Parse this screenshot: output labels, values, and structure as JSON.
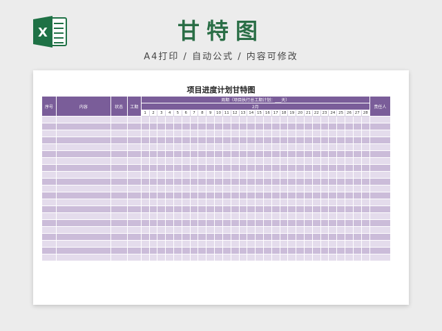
{
  "header": {
    "title": "甘特图",
    "subtitle": "A4打印 / 自动公式 / 内容可修改",
    "logo": {
      "icon": "excel-icon",
      "letter": "X",
      "color": "#1e7145"
    }
  },
  "sheet": {
    "title": "项目进度计划甘特图",
    "columns": {
      "no": "序号",
      "content": "内容",
      "status": "状态",
      "hours": "工期",
      "owner": "责任人"
    },
    "period_label": "周期（项目执行总工期计划：___天）",
    "month_label": "2月",
    "days": [
      "1",
      "2",
      "3",
      "4",
      "5",
      "6",
      "7",
      "8",
      "9",
      "10",
      "11",
      "12",
      "13",
      "14",
      "15",
      "16",
      "17",
      "18",
      "19",
      "20",
      "21",
      "22",
      "23",
      "24",
      "25",
      "26",
      "27",
      "28"
    ],
    "row_count": 21
  },
  "colors": {
    "header_bg": "#7a5d99",
    "row_light": "#e4dcec",
    "row_dark": "#cbbcd9",
    "title_green": "#2a6e46"
  }
}
